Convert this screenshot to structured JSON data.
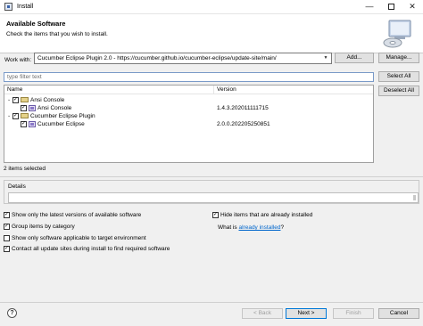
{
  "window": {
    "title": "Install",
    "minimize": "—",
    "maximize": "",
    "close": "✕"
  },
  "header": {
    "title": "Available Software",
    "description": "Check the items that you wish to install."
  },
  "work_with": {
    "label": "Work with:",
    "value": "Cucumber Eclipse Plugin 2.0 - https://cucumber.github.io/cucumber-eclipse/update-site/main/",
    "add_label": "Add...",
    "manage_label": "Manage..."
  },
  "filter": {
    "placeholder": "type filter text"
  },
  "buttons": {
    "select_all": "Select All",
    "deselect_all": "Deselect All"
  },
  "tree": {
    "columns": {
      "name": "Name",
      "version": "Version"
    },
    "items": [
      {
        "label": "Ansi Console",
        "version": "",
        "checked": true,
        "expander": "⌄"
      },
      {
        "label": "Ansi Console",
        "version": "1.4.3.202011111715",
        "checked": true,
        "expander": ""
      },
      {
        "label": "Cucumber Eclipse Plugin",
        "version": "",
        "checked": true,
        "expander": "⌄"
      },
      {
        "label": "Cucumber Eclipse",
        "version": "2.0.0.202205250851",
        "checked": true,
        "expander": ""
      }
    ]
  },
  "selection_status": "2 items selected",
  "details": {
    "label": "Details"
  },
  "options": [
    {
      "label": "Show only the latest versions of available software",
      "checked": true
    },
    {
      "label": "Group items by category",
      "checked": true
    },
    {
      "label": "Show only software applicable to target environment",
      "checked": false
    },
    {
      "label": "Contact all update sites during install to find required software",
      "checked": true
    },
    {
      "label": "Hide items that are already installed",
      "checked": true
    }
  ],
  "what_is": {
    "prefix": "What is ",
    "link": "already installed",
    "suffix": "?"
  },
  "footer": {
    "help": "?",
    "back": "< Back",
    "next": "Next >",
    "finish": "Finish",
    "cancel": "Cancel"
  },
  "check_mark": "✓",
  "colors": {
    "link": "#0066cc",
    "default_button_border": "#0078d7"
  }
}
